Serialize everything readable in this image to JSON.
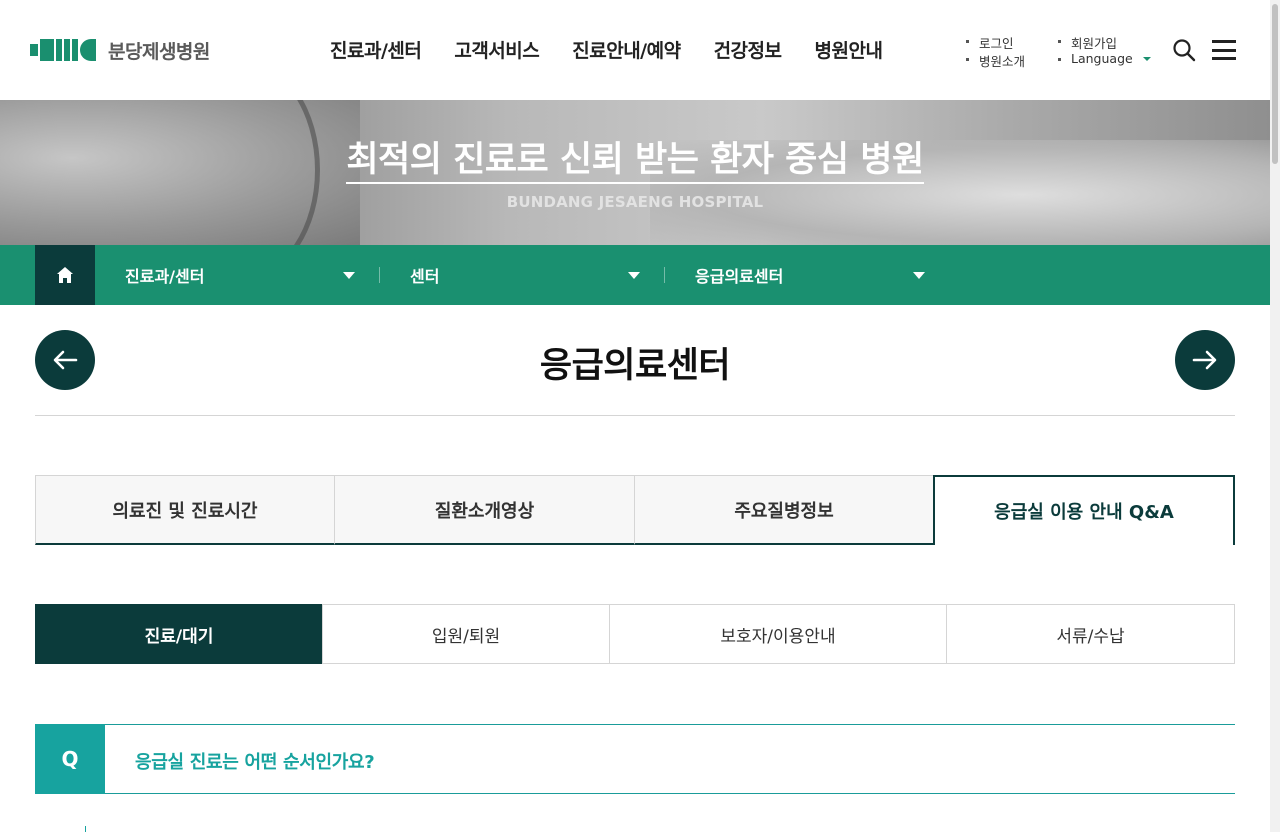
{
  "header": {
    "logo_text": "분당제생병원",
    "nav": [
      "진료과/센터",
      "고객서비스",
      "진료안내/예약",
      "건강정보",
      "병원안내"
    ],
    "util_links": {
      "login": "로그인",
      "join": "회원가입",
      "about": "병원소개",
      "language": "Language"
    }
  },
  "hero": {
    "title": "최적의 진료로 신뢰 받는 환자 중심 병원",
    "subtitle": "BUNDANG JESAENG HOSPITAL"
  },
  "location": {
    "level1": "진료과/센터",
    "level2": "센터",
    "level3": "응급의료센터"
  },
  "page": {
    "title": "응급의료센터"
  },
  "tabs": [
    "의료진 및 진료시간",
    "질환소개영상",
    "주요질병정보",
    "응급실 이용 안내 Q&A"
  ],
  "active_tab": "응급실 이용 안내 Q&A",
  "subtabs": [
    "진료/대기",
    "입원/퇴원",
    "보호자/이용안내",
    "서류/수납"
  ],
  "active_subtab": "진료/대기",
  "qa": {
    "marker": "Q",
    "question": "응급실 진료는 어떤 순서인가요?"
  },
  "colors": {
    "brand_green": "#1a9070",
    "dark_teal": "#0b3b3b",
    "qa_teal": "#17a39f"
  }
}
